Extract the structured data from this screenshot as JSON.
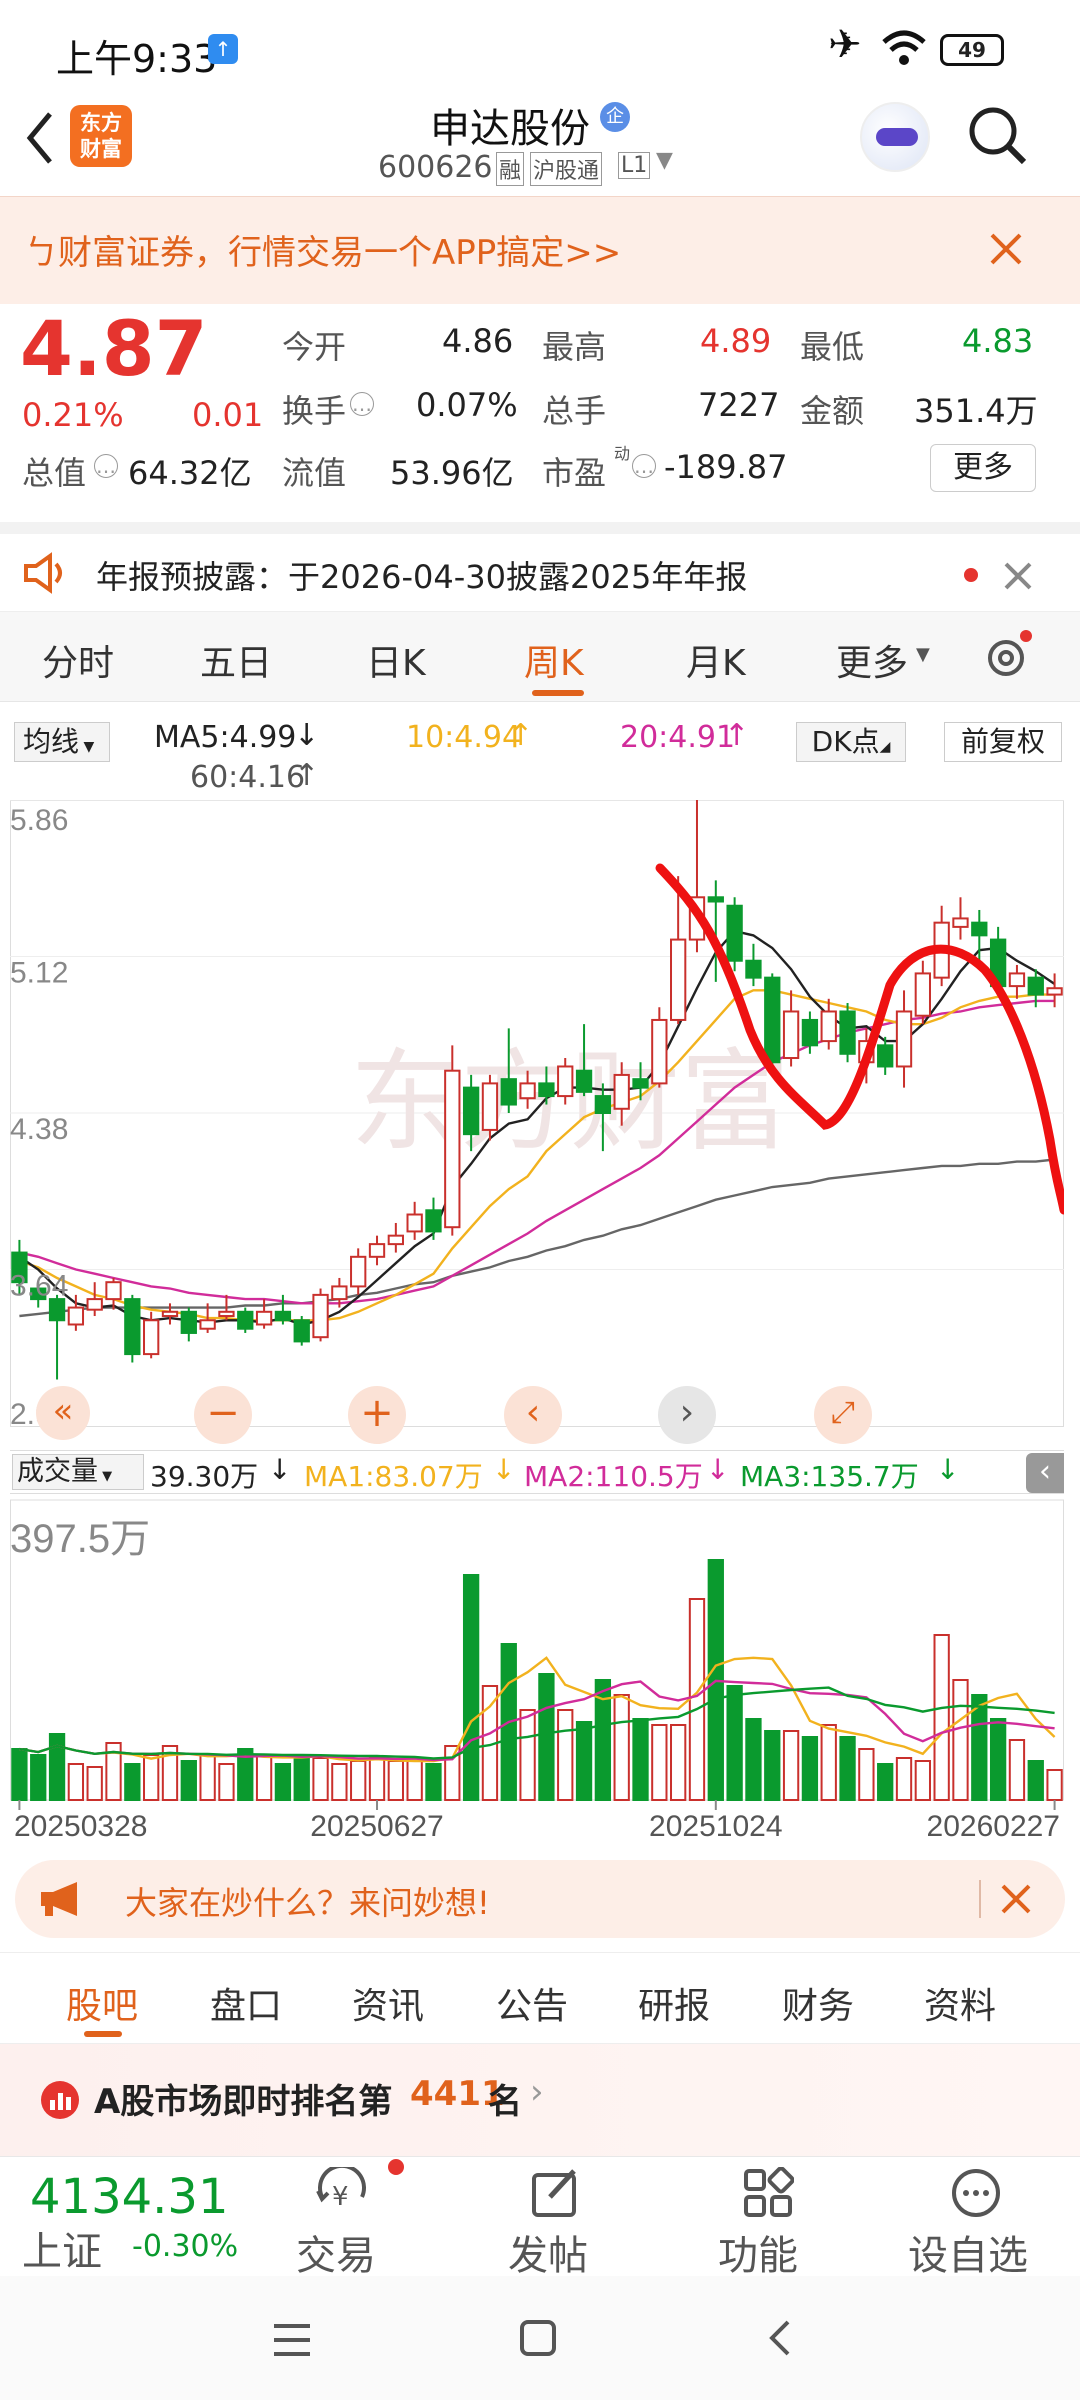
{
  "status": {
    "time": "上午9:33",
    "battery": "49"
  },
  "header": {
    "title": "申达股份",
    "title_badge": "企",
    "code": "600626",
    "tag_rong": "融",
    "tag_hgt": "沪股通",
    "tag_level": "L1",
    "logo_line1": "东方",
    "logo_line2": "财富"
  },
  "banner": {
    "text": "ㄅ财富证券，行情交易一个APP搞定>>"
  },
  "quote": {
    "price": "4.87",
    "pct": "0.21%",
    "chg": "0.01",
    "open_label": "今开",
    "open": "4.86",
    "high_label": "最高",
    "high": "4.89",
    "low_label": "最低",
    "low": "4.83",
    "turnover_label": "换手",
    "turnover": "0.07%",
    "vol_label": "总手",
    "vol": "7227",
    "amount_label": "金额",
    "amount": "351.4万",
    "mktcap_label": "总值",
    "mktcap": "64.32亿",
    "float_label": "流值",
    "float": "53.96亿",
    "pe_label": "市盈",
    "pe_sup": "动",
    "pe": "-189.87",
    "more_button": "更多"
  },
  "notice": {
    "text": "年报预披露：于2026-04-30披露2025年年报"
  },
  "tabs": {
    "items": [
      "分时",
      "五日",
      "日K",
      "周K",
      "月K",
      "更多"
    ],
    "active": 3
  },
  "ma_bar": {
    "selector": "均线",
    "ma5": "MA5:4.99",
    "ma10": "10:4.94",
    "ma20": "20:4.91",
    "ma60": "60:4.16",
    "dk": "DK点",
    "adjust": "前复权"
  },
  "vol_bar": {
    "selector": "成交量",
    "vol": "39.30万",
    "ma1": "MA1:83.07万",
    "ma2": "MA2:110.5万",
    "ma3": "MA3:135.7万"
  },
  "colors": {
    "up": "#c9302c",
    "down": "#0a9a2e",
    "ma5": "#222222",
    "ma10": "#f2b21e",
    "ma20": "#d12c9a",
    "ma60": "#666666",
    "annotation": "#ee1111"
  },
  "chart_data": {
    "type": "candlestick",
    "y_ticks": [
      "5.86",
      "5.12",
      "4.38",
      "3.64",
      "2.90"
    ],
    "ylim": [
      2.9,
      5.86
    ],
    "x_ticks": [
      "20250328",
      "20250627",
      "20251024",
      "20260227"
    ],
    "candles": [
      [
        3.72,
        3.58,
        3.78,
        3.52
      ],
      [
        3.55,
        3.5,
        3.58,
        3.46
      ],
      [
        3.5,
        3.4,
        3.52,
        3.12
      ],
      [
        3.38,
        3.46,
        3.52,
        3.35
      ],
      [
        3.45,
        3.5,
        3.58,
        3.42
      ],
      [
        3.5,
        3.58,
        3.6,
        3.45
      ],
      [
        3.5,
        3.24,
        3.52,
        3.2
      ],
      [
        3.24,
        3.4,
        3.44,
        3.22
      ],
      [
        3.42,
        3.44,
        3.48,
        3.38
      ],
      [
        3.44,
        3.34,
        3.46,
        3.3
      ],
      [
        3.36,
        3.4,
        3.48,
        3.34
      ],
      [
        3.42,
        3.44,
        3.52,
        3.4
      ],
      [
        3.44,
        3.36,
        3.46,
        3.34
      ],
      [
        3.38,
        3.44,
        3.5,
        3.36
      ],
      [
        3.44,
        3.4,
        3.52,
        3.38
      ],
      [
        3.4,
        3.3,
        3.42,
        3.28
      ],
      [
        3.32,
        3.52,
        3.55,
        3.3
      ],
      [
        3.5,
        3.56,
        3.6,
        3.46
      ],
      [
        3.56,
        3.7,
        3.74,
        3.52
      ],
      [
        3.7,
        3.76,
        3.8,
        3.66
      ],
      [
        3.76,
        3.8,
        3.86,
        3.72
      ],
      [
        3.82,
        3.9,
        3.96,
        3.78
      ],
      [
        3.92,
        3.82,
        3.98,
        3.78
      ],
      [
        3.84,
        4.58,
        4.7,
        3.8
      ],
      [
        4.5,
        4.28,
        4.56,
        4.2
      ],
      [
        4.3,
        4.52,
        4.56,
        4.25
      ],
      [
        4.54,
        4.42,
        4.78,
        4.38
      ],
      [
        4.45,
        4.52,
        4.58,
        4.4
      ],
      [
        4.52,
        4.46,
        4.6,
        4.42
      ],
      [
        4.46,
        4.6,
        4.64,
        4.42
      ],
      [
        4.58,
        4.48,
        4.8,
        4.46
      ],
      [
        4.46,
        4.38,
        4.52,
        4.2
      ],
      [
        4.4,
        4.56,
        4.62,
        4.32
      ],
      [
        4.54,
        4.5,
        4.62,
        4.44
      ],
      [
        4.52,
        4.82,
        4.88,
        4.5
      ],
      [
        4.82,
        5.2,
        5.5,
        4.8
      ],
      [
        5.2,
        5.4,
        5.86,
        5.14
      ],
      [
        5.4,
        5.38,
        5.48,
        5.0
      ],
      [
        5.36,
        5.1,
        5.4,
        5.05
      ],
      [
        5.1,
        5.02,
        5.18,
        4.98
      ],
      [
        5.02,
        4.62,
        5.04,
        4.58
      ],
      [
        4.64,
        4.86,
        4.96,
        4.6
      ],
      [
        4.82,
        4.7,
        4.86,
        4.66
      ],
      [
        4.72,
        4.86,
        4.92,
        4.68
      ],
      [
        4.86,
        4.66,
        4.9,
        4.62
      ],
      [
        4.62,
        4.72,
        4.78,
        4.52
      ],
      [
        4.7,
        4.6,
        4.74,
        4.56
      ],
      [
        4.6,
        4.86,
        4.96,
        4.5
      ],
      [
        4.84,
        5.04,
        5.1,
        4.8
      ],
      [
        5.02,
        5.28,
        5.36,
        4.98
      ],
      [
        5.26,
        5.3,
        5.4,
        5.2
      ],
      [
        5.28,
        5.22,
        5.34,
        5.08
      ],
      [
        5.2,
        4.98,
        5.26,
        4.94
      ],
      [
        4.98,
        5.04,
        5.08,
        4.92
      ],
      [
        5.02,
        4.94,
        5.06,
        4.88
      ],
      [
        4.94,
        4.97,
        5.04,
        4.88
      ]
    ],
    "ma5": [
      3.7,
      3.64,
      3.55,
      3.48,
      3.46,
      3.47,
      3.42,
      3.4,
      3.41,
      3.4,
      3.39,
      3.4,
      3.4,
      3.39,
      3.41,
      3.38,
      3.4,
      3.44,
      3.51,
      3.59,
      3.67,
      3.75,
      3.81,
      4.03,
      4.14,
      4.26,
      4.33,
      4.35,
      4.45,
      4.5,
      4.5,
      4.49,
      4.49,
      4.5,
      4.61,
      4.79,
      4.97,
      5.14,
      5.24,
      5.22,
      5.16,
      5.06,
      4.93,
      4.84,
      4.78,
      4.79,
      4.72,
      4.72,
      4.8,
      4.92,
      5.05,
      5.15,
      5.16,
      5.1,
      5.05,
      4.99
    ],
    "ma10": [
      3.68,
      3.65,
      3.6,
      3.56,
      3.52,
      3.5,
      3.47,
      3.45,
      3.44,
      3.43,
      3.41,
      3.41,
      3.4,
      3.4,
      3.4,
      3.4,
      3.4,
      3.41,
      3.44,
      3.48,
      3.52,
      3.57,
      3.62,
      3.74,
      3.84,
      3.94,
      4.02,
      4.08,
      4.2,
      4.28,
      4.36,
      4.4,
      4.43,
      4.46,
      4.53,
      4.62,
      4.72,
      4.82,
      4.92,
      4.96,
      4.96,
      4.94,
      4.92,
      4.9,
      4.88,
      4.86,
      4.82,
      4.8,
      4.8,
      4.83,
      4.88,
      4.91,
      4.93,
      4.93,
      4.94,
      4.94
    ],
    "ma20": [
      3.72,
      3.7,
      3.67,
      3.64,
      3.62,
      3.6,
      3.58,
      3.56,
      3.55,
      3.53,
      3.52,
      3.51,
      3.5,
      3.5,
      3.49,
      3.48,
      3.48,
      3.48,
      3.49,
      3.5,
      3.52,
      3.54,
      3.56,
      3.61,
      3.66,
      3.71,
      3.76,
      3.81,
      3.87,
      3.92,
      3.97,
      4.02,
      4.07,
      4.12,
      4.18,
      4.26,
      4.34,
      4.42,
      4.5,
      4.56,
      4.62,
      4.66,
      4.7,
      4.73,
      4.76,
      4.78,
      4.8,
      4.82,
      4.83,
      4.85,
      4.86,
      4.88,
      4.89,
      4.9,
      4.91,
      4.91
    ],
    "ma60": [
      3.42,
      3.43,
      3.44,
      3.45,
      3.46,
      3.46,
      3.46,
      3.46,
      3.46,
      3.46,
      3.46,
      3.46,
      3.47,
      3.47,
      3.48,
      3.48,
      3.49,
      3.5,
      3.52,
      3.53,
      3.55,
      3.57,
      3.58,
      3.61,
      3.63,
      3.65,
      3.68,
      3.7,
      3.73,
      3.75,
      3.78,
      3.8,
      3.83,
      3.85,
      3.88,
      3.91,
      3.94,
      3.97,
      3.99,
      4.01,
      4.03,
      4.04,
      4.05,
      4.07,
      4.08,
      4.09,
      4.1,
      4.11,
      4.12,
      4.13,
      4.13,
      4.14,
      4.14,
      4.15,
      4.15,
      4.16
    ],
    "volume_max": "397.5万",
    "volumes": [
      0.17,
      0.15,
      0.22,
      0.12,
      0.11,
      0.19,
      0.12,
      0.15,
      0.18,
      0.13,
      0.15,
      0.12,
      0.17,
      0.15,
      0.12,
      0.15,
      0.14,
      0.12,
      0.13,
      0.14,
      0.13,
      0.13,
      0.12,
      0.18,
      0.75,
      0.38,
      0.52,
      0.3,
      0.42,
      0.3,
      0.26,
      0.4,
      0.35,
      0.27,
      0.25,
      0.25,
      0.67,
      0.8,
      0.38,
      0.27,
      0.23,
      0.23,
      0.21,
      0.25,
      0.21,
      0.17,
      0.12,
      0.14,
      0.13,
      0.55,
      0.4,
      0.35,
      0.27,
      0.2,
      0.13,
      0.1
    ]
  },
  "ask": {
    "text": "大家在炒什么？来问妙想!"
  },
  "subtabs": {
    "items": [
      "股吧",
      "盘口",
      "资讯",
      "公告",
      "研报",
      "财务",
      "资料"
    ],
    "active": 0
  },
  "rank": {
    "prefix": "A股市场即时排名第",
    "num": "4411",
    "suffix": "名"
  },
  "bottom": {
    "index_value": "4134.31",
    "index_name": "上证",
    "index_pct": "-0.30%",
    "items": [
      "交易",
      "发帖",
      "功能",
      "设自选"
    ]
  }
}
